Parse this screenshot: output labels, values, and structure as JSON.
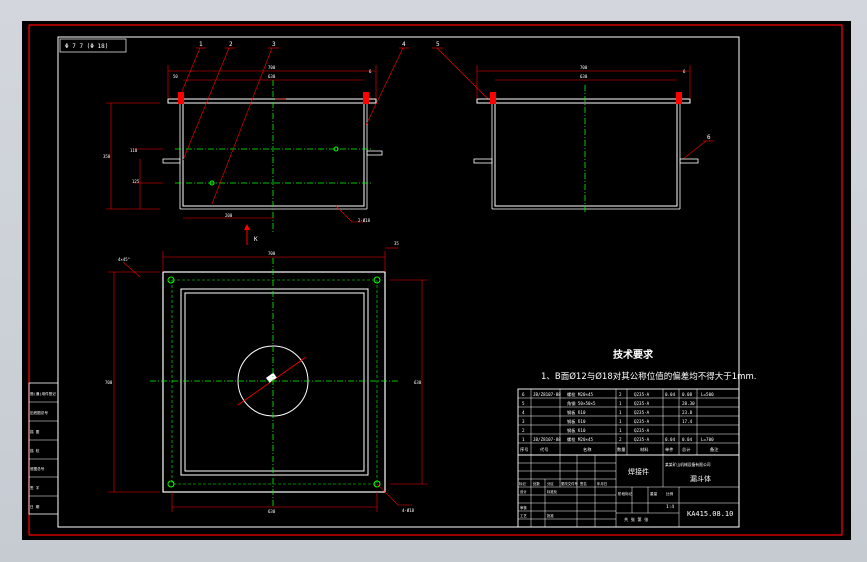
{
  "drawing": {
    "corner_tag": "Φ 7 7 (Φ 18)",
    "technical_requirements": {
      "title": "技术要求",
      "note": "1、B面Ø12与Ø18对其公称位值的偏差均不得大于1mm."
    },
    "balloons": [
      "1",
      "2",
      "3",
      "4",
      "5",
      "6"
    ],
    "view_labels": {
      "section_arrow": "K"
    },
    "dimensions": {
      "front_overall": "700",
      "front_inner": "630",
      "front_left": "50",
      "front_right": "6",
      "front_height": "350",
      "front_side_a": "110",
      "front_side_b": "125",
      "front_bottom": "200",
      "front_tag": "2-Ø18",
      "side_overall": "700",
      "side_inner": "630",
      "side_right": "6",
      "plan_overall": "700",
      "plan_height": "700",
      "plan_inner": "630",
      "plan_right_height": "630",
      "plan_left_tag": "4×45°",
      "plan_corner": "35",
      "plan_bottom_tag": "4-Ø18"
    },
    "left_strip": [
      "借(通)用件登记",
      "旧底图总号",
      "描  图",
      "描  校",
      "底图总号",
      "签  字",
      "日  期"
    ],
    "bom": {
      "rows": [
        [
          "6",
          "JB/Z8107-88",
          "螺栓 M20×45",
          "2",
          "Q235-A",
          "0.04",
          "0.08",
          "L=500"
        ],
        [
          "5",
          "",
          "角钢 50×50×5",
          "1",
          "Q235-A",
          "",
          "28.30",
          ""
        ],
        [
          "4",
          "",
          "钢板 δ10",
          "1",
          "Q235-A",
          "",
          "23.8",
          ""
        ],
        [
          "3",
          "",
          "钢板 δ10",
          "1",
          "Q235-A",
          "",
          "17.4",
          ""
        ],
        [
          "2",
          "",
          "钢板 δ10",
          "1",
          "Q235-A",
          "",
          "",
          ""
        ],
        [
          "1",
          "JB/Z8107-88",
          "螺栓 M20×45",
          "2",
          "Q235-A",
          "0.04",
          "0.04",
          "L=700"
        ]
      ],
      "header": [
        "序号",
        "代号",
        "名称",
        "数量",
        "材料",
        "单件",
        "总计",
        "备注"
      ]
    },
    "title_block": {
      "part_name": "焊接件",
      "company": "某某矿山机械设备有限公司",
      "drawing_name": "漏斗体",
      "drawing_number": "KA415.08.10",
      "stage_label": "阶段标记",
      "weight_label": "重量",
      "scale_label": "比例",
      "scale_value": "1:4",
      "sheets": "共 张  第 张",
      "signature_cols": [
        "标记",
        "处数",
        "分区",
        "更改文件号",
        "签名",
        "年月日"
      ],
      "role_rows": [
        "设计",
        "审核",
        "工艺",
        "标准化",
        "批准"
      ]
    }
  },
  "colors": {
    "background": "#000000",
    "frame": "#ff0000",
    "border": "#ffffff",
    "geometry": "#ffffff",
    "centerline": "#00ff00",
    "dimension": "#ff0000",
    "text": "#ffffff"
  }
}
